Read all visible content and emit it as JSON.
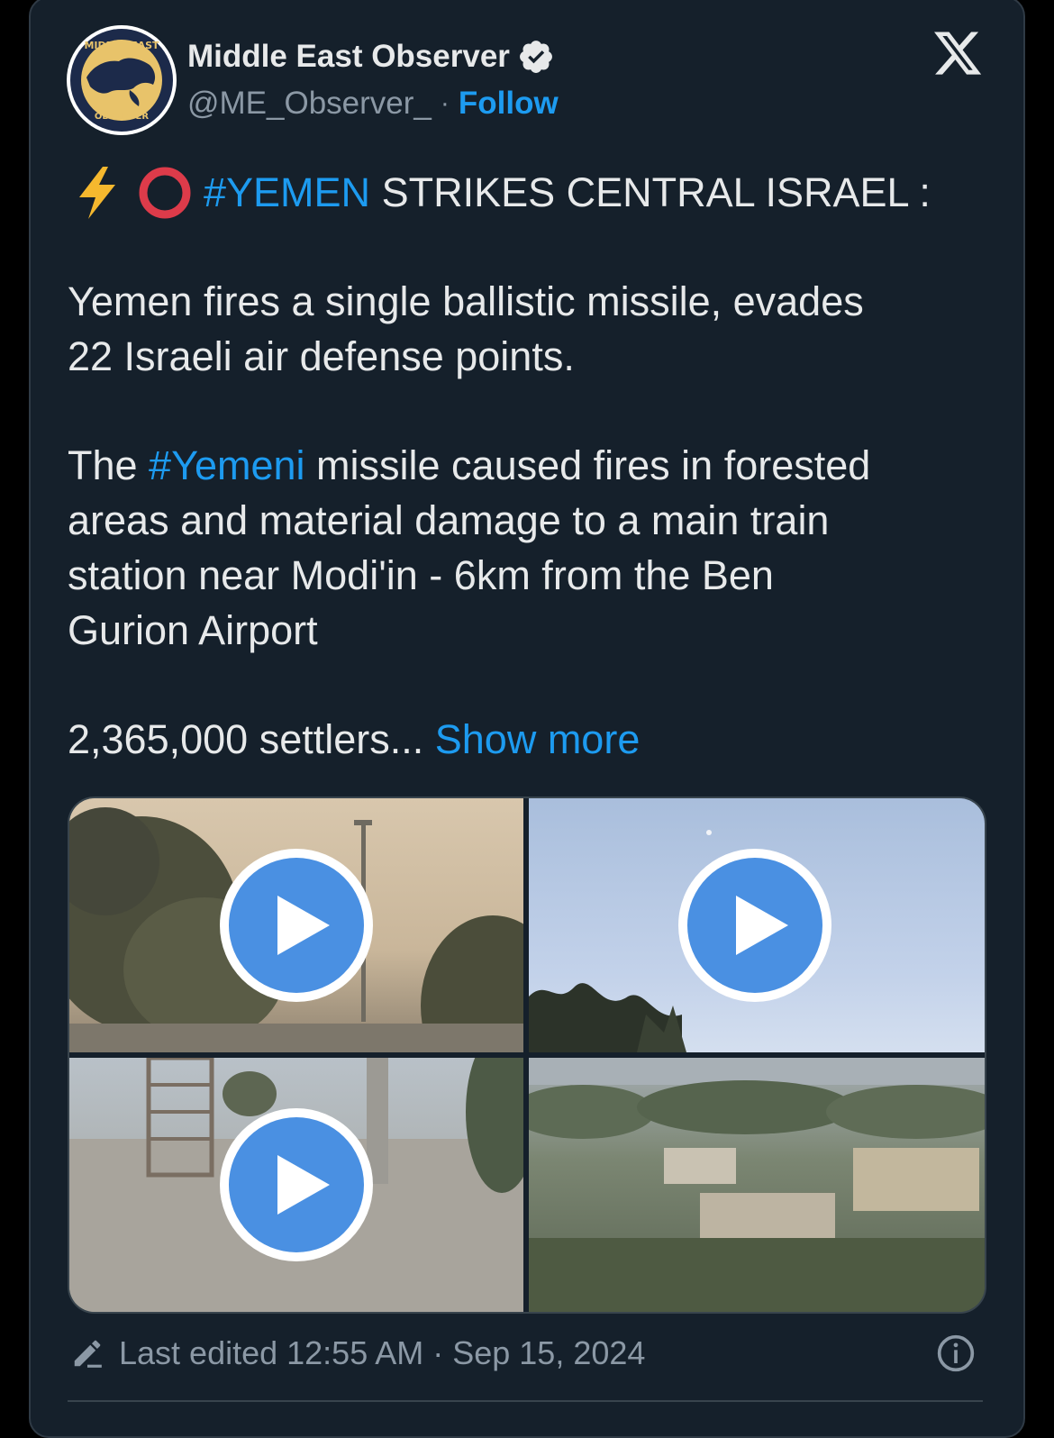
{
  "author": {
    "name": "Middle East Observer",
    "handle": "@ME_Observer_",
    "separator": "·",
    "follow_label": "Follow",
    "avatar_icon": "middle-east-observer-logo",
    "verified_icon": "verified-badge-icon"
  },
  "platform_icon": "x-logo-icon",
  "post": {
    "headline_hashtag": "#YEMEN",
    "headline_text": " STRIKES CENTRAL ISRAEL :",
    "headline_emojis": [
      "lightning-emoji",
      "red-circle-emoji"
    ],
    "para1_line1": "Yemen fires a single ballistic missile, evades",
    "para1_line2": "22 Israeli air defense points.",
    "para2_line1_prefix": "The ",
    "para2_hashtag": "#Yemeni",
    "para2_line1_suffix": " missile caused fires in forested",
    "para2_line2": "areas and material damage to a main train",
    "para2_line3": "station near Modi'in - 6km from the Ben",
    "para2_line4": "Gurion Airport",
    "para3_text": "2,365,000 settlers... ",
    "show_more_label": "Show more"
  },
  "media": [
    {
      "type": "video",
      "scene": "trees and lamp post in hazy sky"
    },
    {
      "type": "video",
      "scene": "blue sky with tree silhouette"
    },
    {
      "type": "video",
      "scene": "scaffolding and dusty road"
    },
    {
      "type": "image",
      "scene": "houses and trees landscape"
    }
  ],
  "footer": {
    "edited_text": "Last edited 12:55 AM · Sep 15, 2024",
    "edit_icon": "pencil-icon",
    "info_icon": "info-icon"
  },
  "colors": {
    "background": "#15202b",
    "link": "#1d9bf0",
    "text": "#e7e9ea",
    "muted": "#8b98a5",
    "play_button": "#4a90e2"
  }
}
